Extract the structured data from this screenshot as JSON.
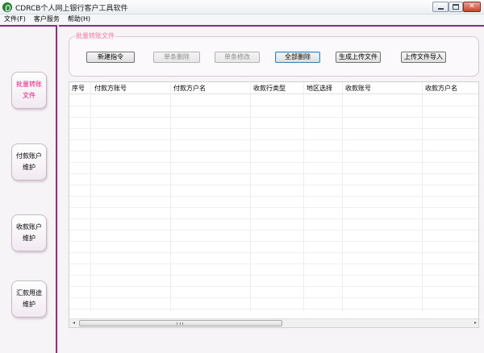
{
  "window": {
    "title": "CDRCB个人网上银行客户工具软件",
    "icon": "bank-logo-icon",
    "controls": {
      "minimize_icon": "minimize-icon",
      "maximize_icon": "maximize-icon",
      "close_icon": "close-icon",
      "close_glyph": "✕"
    }
  },
  "menu": {
    "items": [
      {
        "label": "文件(F)"
      },
      {
        "label": "客户服务"
      },
      {
        "label": "帮助(H)"
      }
    ]
  },
  "sidebar": {
    "items": [
      {
        "line1": "批量转账",
        "line2": "文件",
        "active": true
      },
      {
        "line1": "付款账户",
        "line2": "维护",
        "active": false
      },
      {
        "line1": "收款账户",
        "line2": "维护",
        "active": false
      },
      {
        "line1": "汇款用途",
        "line2": "维护",
        "active": false
      }
    ]
  },
  "toolbar": {
    "group_title": "批量转账文件",
    "buttons": [
      {
        "label": "新建指令",
        "enabled": true
      },
      {
        "label": "单条删除",
        "enabled": false
      },
      {
        "label": "单条修改",
        "enabled": false
      },
      {
        "label": "全部删除",
        "enabled": true,
        "focused": true
      },
      {
        "label": "生成上传文件",
        "enabled": true
      },
      {
        "label": "上传文件导入",
        "enabled": true
      }
    ]
  },
  "table": {
    "columns": [
      "序号",
      "付款方账号",
      "付款方户名",
      "收款行类型",
      "地区选择",
      "收款账号",
      "收款方户名"
    ],
    "rows": []
  },
  "scrollbar": {
    "left_arrow": "◂",
    "right_arrow": "▸"
  },
  "colors": {
    "accent": "#8a2c86",
    "active_nav_text": "#e0177a",
    "group_title": "#f07aa0"
  }
}
